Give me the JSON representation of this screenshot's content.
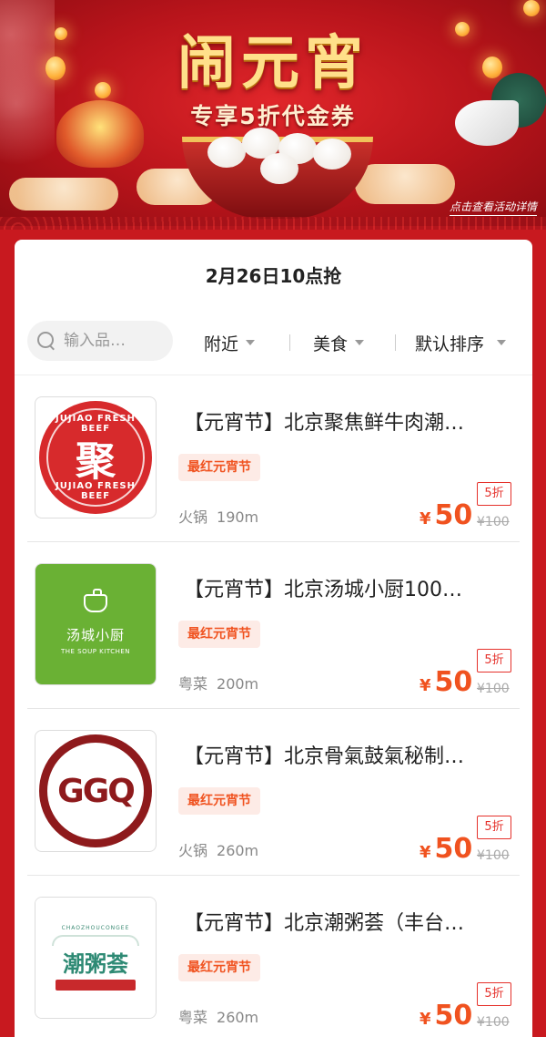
{
  "banner": {
    "title": "闹元宵",
    "subtitle": "专享5折代金券",
    "details_link": "点击查看活动详情"
  },
  "card": {
    "date_label": "2月26日10点抢"
  },
  "search": {
    "placeholder": "输入品…",
    "icon": "search-icon"
  },
  "filters": {
    "nearby": "附近",
    "category": "美食",
    "sort": "默认排序"
  },
  "items": [
    {
      "title": "【元宵节】北京聚焦鲜牛肉潮…",
      "tag": "最红元宵节",
      "category": "火锅",
      "distance": "190m",
      "discount": "5折",
      "currency": "¥",
      "price": "50",
      "original_price": "¥100",
      "logo": {
        "center": "聚",
        "top": "JUJIAO FRESH BEEF",
        "bottom": "JUJIAO FRESH BEEF"
      }
    },
    {
      "title": "【元宵节】北京汤城小厨100…",
      "tag": "最红元宵节",
      "category": "粤菜",
      "distance": "200m",
      "discount": "5折",
      "currency": "¥",
      "price": "50",
      "original_price": "¥100",
      "logo": {
        "cn": "汤城小厨",
        "en": "THE SOUP KITCHEN"
      }
    },
    {
      "title": "【元宵节】北京骨氣鼓氣秘制…",
      "tag": "最红元宵节",
      "category": "火锅",
      "distance": "260m",
      "discount": "5折",
      "currency": "¥",
      "price": "50",
      "original_price": "¥100",
      "logo": {
        "mark": "GGQ"
      }
    },
    {
      "title": "【元宵节】北京潮粥荟（丰台…",
      "tag": "最红元宵节",
      "category": "粤菜",
      "distance": "260m",
      "discount": "5折",
      "currency": "¥",
      "price": "50",
      "original_price": "¥100",
      "logo": {
        "en": "CHAOZHOUCONGEE",
        "cn": "潮粥荟"
      }
    }
  ],
  "colors": {
    "page_background": "#c8191f",
    "accent_price": "#f0521f",
    "discount_red": "#e5312b"
  }
}
